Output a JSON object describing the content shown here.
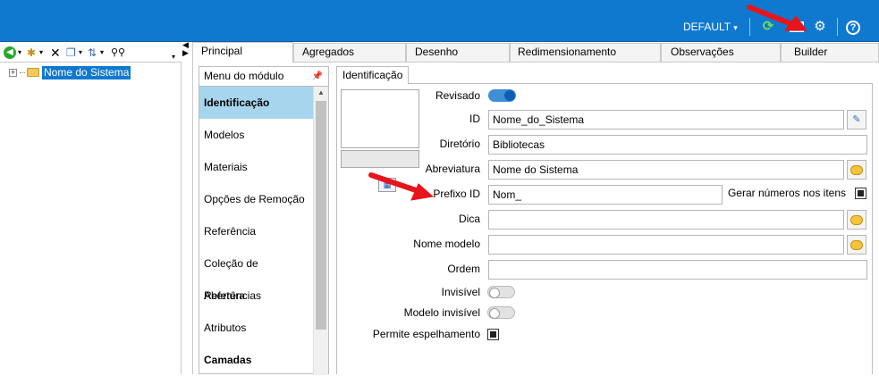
{
  "topbar": {
    "profile": "DEFAULT",
    "profile_caret": "▾",
    "help": "?"
  },
  "icons": {
    "refresh": "refresh-icon",
    "settings": "gear-icon",
    "help": "help-icon"
  },
  "tree": {
    "root_label": "Nome do Sistema"
  },
  "tabs": [
    {
      "label": "Principal"
    },
    {
      "label": "Agregados"
    },
    {
      "label": "Desenho"
    },
    {
      "label": "Redimensionamento"
    },
    {
      "label": "Observações"
    },
    {
      "label": "Builder"
    }
  ],
  "module_menu": {
    "title": "Menu do módulo",
    "items": [
      {
        "label": "Identificação"
      },
      {
        "label": "Modelos"
      },
      {
        "label": "Materiais"
      },
      {
        "label": "Opções de Remoção"
      },
      {
        "label": "Referência"
      },
      {
        "label": "Coleção de Referências"
      },
      {
        "label": "Abertura"
      },
      {
        "label": "Atributos"
      },
      {
        "label": "Camadas"
      }
    ]
  },
  "inner_tab": "Identificação",
  "form": {
    "revisado_label": "Revisado",
    "revisado_on": true,
    "id_label": "ID",
    "id_value": "Nome_do_Sistema",
    "diretorio_label": "Diretório",
    "diretorio_value": "Bibliotecas",
    "abreviatura_label": "Abreviatura",
    "abreviatura_value": "Nome do Sistema",
    "prefixo_label": "Prefixo ID",
    "prefixo_value": "Nom_",
    "gerar_label": "Gerar números nos itens",
    "gerar_checked": true,
    "dica_label": "Dica",
    "dica_value": "",
    "nome_modelo_label": "Nome modelo",
    "nome_modelo_value": "",
    "ordem_label": "Ordem",
    "ordem_value": "",
    "invisivel_label": "Invisível",
    "invisivel_on": false,
    "modelo_invisivel_label": "Modelo invisível",
    "modelo_invisivel_on": false,
    "espelhamento_label": "Permite espelhamento",
    "espelhamento_checked": true
  },
  "colors": {
    "topbar": "#0f79d0",
    "selection": "#a8d5ee",
    "annotation_arrow": "#e8141c"
  }
}
